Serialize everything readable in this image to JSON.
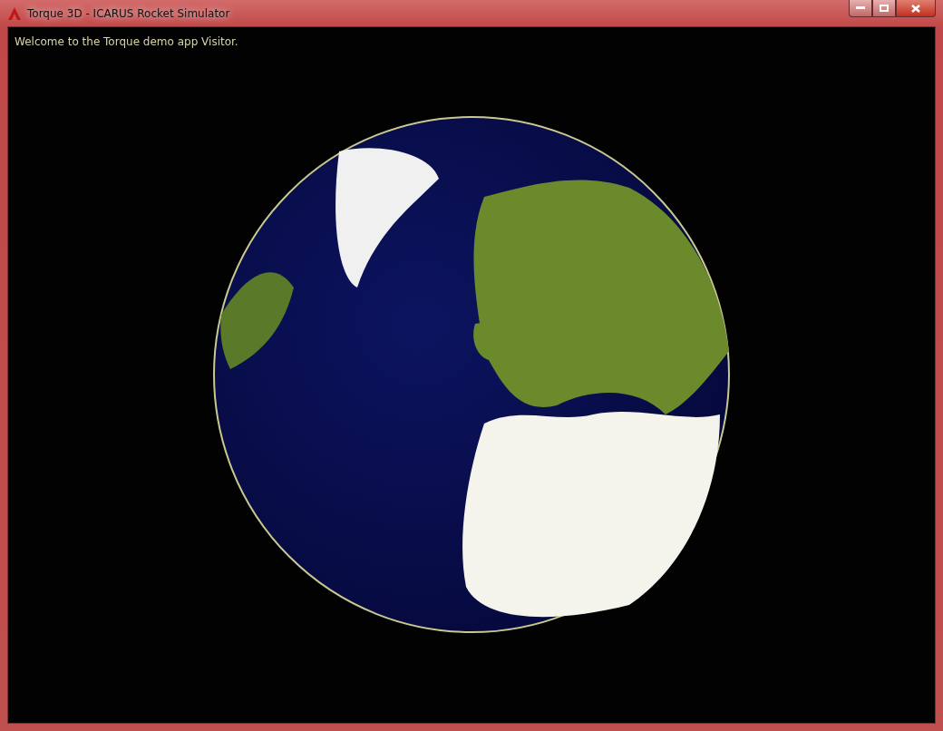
{
  "window": {
    "title": "Torque 3D - ICARUS Rocket Simulator"
  },
  "viewport": {
    "message": "Welcome to the Torque demo app Visitor."
  }
}
